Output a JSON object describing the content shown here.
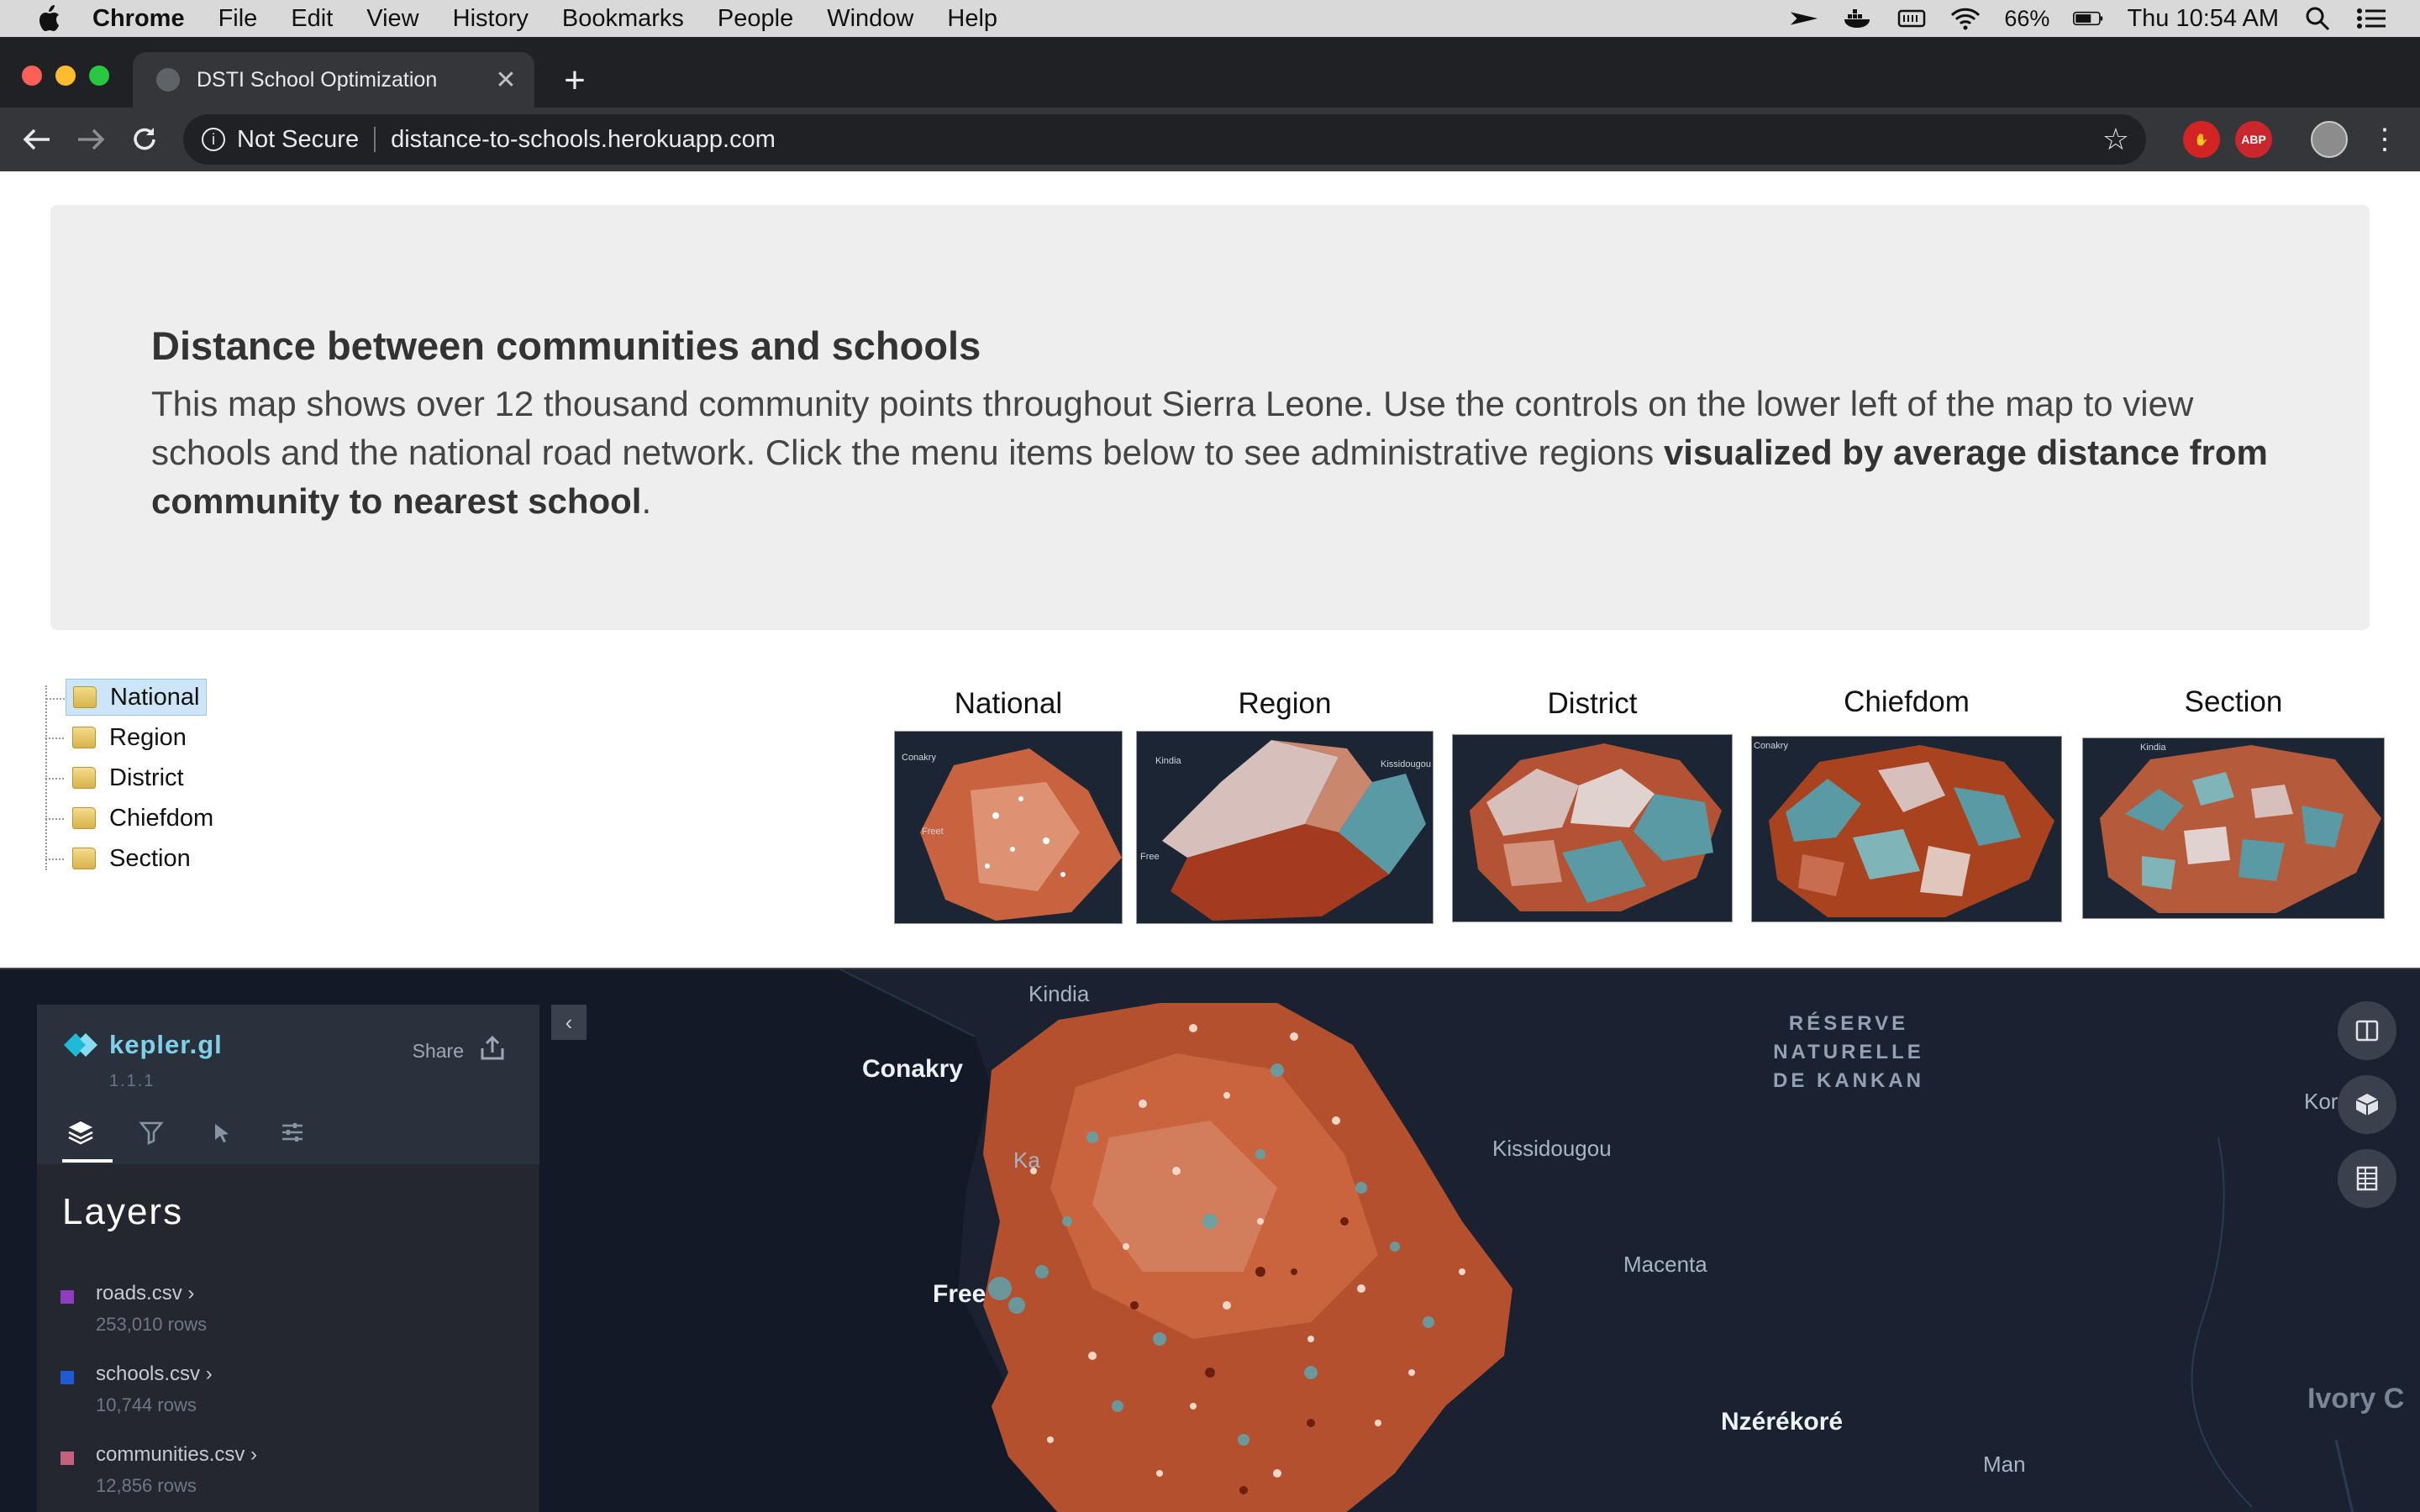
{
  "menubar": {
    "app_name": "Chrome",
    "items": [
      "File",
      "Edit",
      "View",
      "History",
      "Bookmarks",
      "People",
      "Window",
      "Help"
    ],
    "battery": "66%",
    "clock": "Thu 10:54 AM"
  },
  "browser": {
    "tab_title": "DSTI School Optimization",
    "security_label": "Not Secure",
    "url": "distance-to-schools.herokuapp.com",
    "ext_abp": "ABP"
  },
  "intro": {
    "heading": "Distance between communities and schools",
    "body_plain": "This map shows over 12 thousand community points throughout Sierra Leone. Use the controls on the lower left of the map to view schools and the national road network. Click the menu items below to see administrative regions ",
    "body_bold": "visualized by average distance from community to nearest school",
    "body_end": "."
  },
  "tree": {
    "items": [
      "National",
      "Region",
      "District",
      "Chiefdom",
      "Section"
    ],
    "selected": "National"
  },
  "thumbnails": [
    {
      "label": "National"
    },
    {
      "label": "Region"
    },
    {
      "label": "District"
    },
    {
      "label": "Chiefdom"
    },
    {
      "label": "Section"
    }
  ],
  "thumbnail_place_labels": [
    "Conakry",
    "Freet",
    "Kindia",
    "Kissidougou",
    "Free",
    "Conakry",
    "Kindia"
  ],
  "map": {
    "place_labels": {
      "kindia": "Kindia",
      "conakry": "Conakry",
      "kissidougou": "Kissidougou",
      "macenta": "Macenta",
      "freetown": "Free",
      "kamsar": "Ka",
      "nzerekore": "Nzérékoré",
      "man": "Man",
      "ivory": "Ivory C",
      "kor": "Kor"
    },
    "reserve_lines": [
      "RÉSERVE",
      "NATURELLE",
      "DE KANKAN"
    ],
    "colors": {
      "land_dark": "#1a2232",
      "points_primary": "#c6552f",
      "points_secondary": "#5ea5ad",
      "points_light": "#f3d6c8"
    }
  },
  "kepler": {
    "name": "kepler.gl",
    "version": "1.1.1",
    "share_label": "Share",
    "section_title": "Layers",
    "layers": [
      {
        "name": "roads.csv",
        "rows": "253,010 rows",
        "color": "#8e3cc0"
      },
      {
        "name": "schools.csv",
        "rows": "10,744 rows",
        "color": "#1f5ad6"
      },
      {
        "name": "communities.csv",
        "rows": "12,856 rows",
        "color": "#c4627c"
      }
    ]
  }
}
